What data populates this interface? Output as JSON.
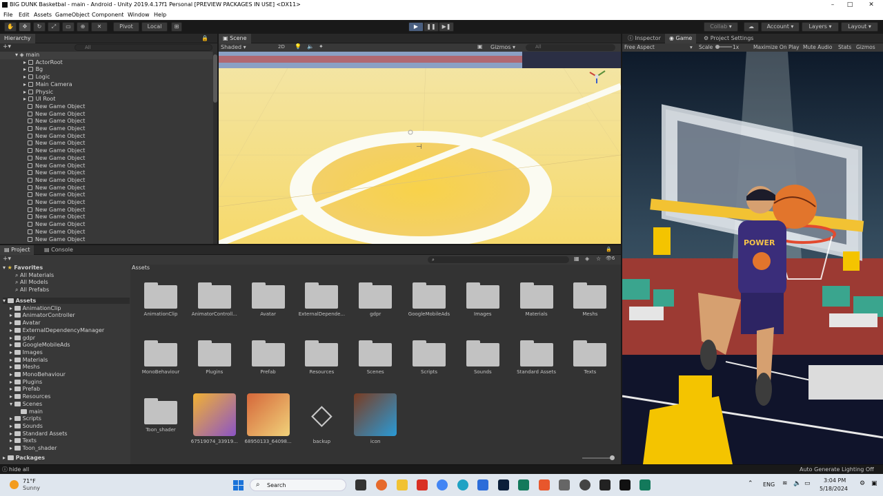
{
  "window": {
    "title": "BIG DUNK Basketbal - main - Android - Unity 2019.4.17f1 Personal [PREVIEW PACKAGES IN USE] <DX11>",
    "controls": [
      "–",
      "□",
      "✕"
    ]
  },
  "menu": [
    "File",
    "Edit",
    "Assets",
    "GameObject",
    "Component",
    "Window",
    "Help"
  ],
  "toolbar": {
    "pivot": "Pivot",
    "local": "Local",
    "collab": "Collab",
    "account": "Account",
    "layers": "Layers",
    "layout": "Layout"
  },
  "hierarchy": {
    "tab": "Hierarchy",
    "search_placeholder": "All",
    "scene": "main",
    "items": [
      "ActorRoot",
      "Bg",
      "Logic",
      "Main Camera",
      "Physic",
      "UI Root",
      "New Game Object",
      "New Game Object",
      "New Game Object",
      "New Game Object",
      "New Game Object",
      "New Game Object",
      "New Game Object",
      "New Game Object",
      "New Game Object",
      "New Game Object",
      "New Game Object",
      "New Game Object",
      "New Game Object",
      "New Game Object",
      "New Game Object",
      "New Game Object",
      "New Game Object",
      "New Game Object",
      "New Game Object"
    ]
  },
  "scene": {
    "tab": "Scene",
    "shading": "Shaded",
    "mode2d": "2D",
    "gizmos": "Gizmos",
    "search": "All"
  },
  "game": {
    "tabs": [
      "Inspector",
      "Game",
      "Project Settings"
    ],
    "aspect": "Free Aspect",
    "scale_label": "Scale",
    "scale_value": "1x",
    "maximize": "Maximize On Play",
    "mute": "Mute Audio",
    "stats": "Stats",
    "gizmos": "Gizmos",
    "jersey": "POWER"
  },
  "project": {
    "tabs": [
      "Project",
      "Console"
    ],
    "breadcrumb": "Assets",
    "badge": "6",
    "favorites": {
      "label": "Favorites",
      "items": [
        "All Materials",
        "All Models",
        "All Prefabs"
      ]
    },
    "tree": {
      "root": "Assets",
      "items": [
        "AnimationClip",
        "AnimatorController",
        "Avatar",
        "ExternalDependencyManager",
        "gdpr",
        "GoogleMobileAds",
        "Images",
        "Materials",
        "Meshs",
        "MonoBehaviour",
        "Plugins",
        "Prefab",
        "Resources",
        "Scenes",
        "main",
        "Scripts",
        "Sounds",
        "Standard Assets",
        "Texts",
        "Toon_shader"
      ],
      "packages": "Packages"
    },
    "assets_row1": [
      "AnimationClip",
      "AnimatorControll...",
      "Avatar",
      "ExternalDepende...",
      "gdpr",
      "GoogleMobileAds",
      "Images",
      "Materials",
      "Meshs"
    ],
    "assets_row2": [
      "MonoBehaviour",
      "Plugins",
      "Prefab",
      "Resources",
      "Scenes",
      "Scripts",
      "Sounds",
      "Standard Assets",
      "Texts"
    ],
    "assets_row3": [
      "Toon_shader",
      "67519074_33919...",
      "68950133_64098...",
      "backup",
      "icon"
    ]
  },
  "status": {
    "left": "hide all",
    "right": "Auto Generate Lighting Off"
  },
  "taskbar": {
    "weather_temp": "71°F",
    "weather_desc": "Sunny",
    "search": "Search",
    "lang": "ENG",
    "time": "3:04 PM",
    "date": "5/18/2024"
  },
  "colors": {
    "accent": "#4a5f80",
    "court": "#f6d96b",
    "jersey": "#3a2d7a"
  }
}
